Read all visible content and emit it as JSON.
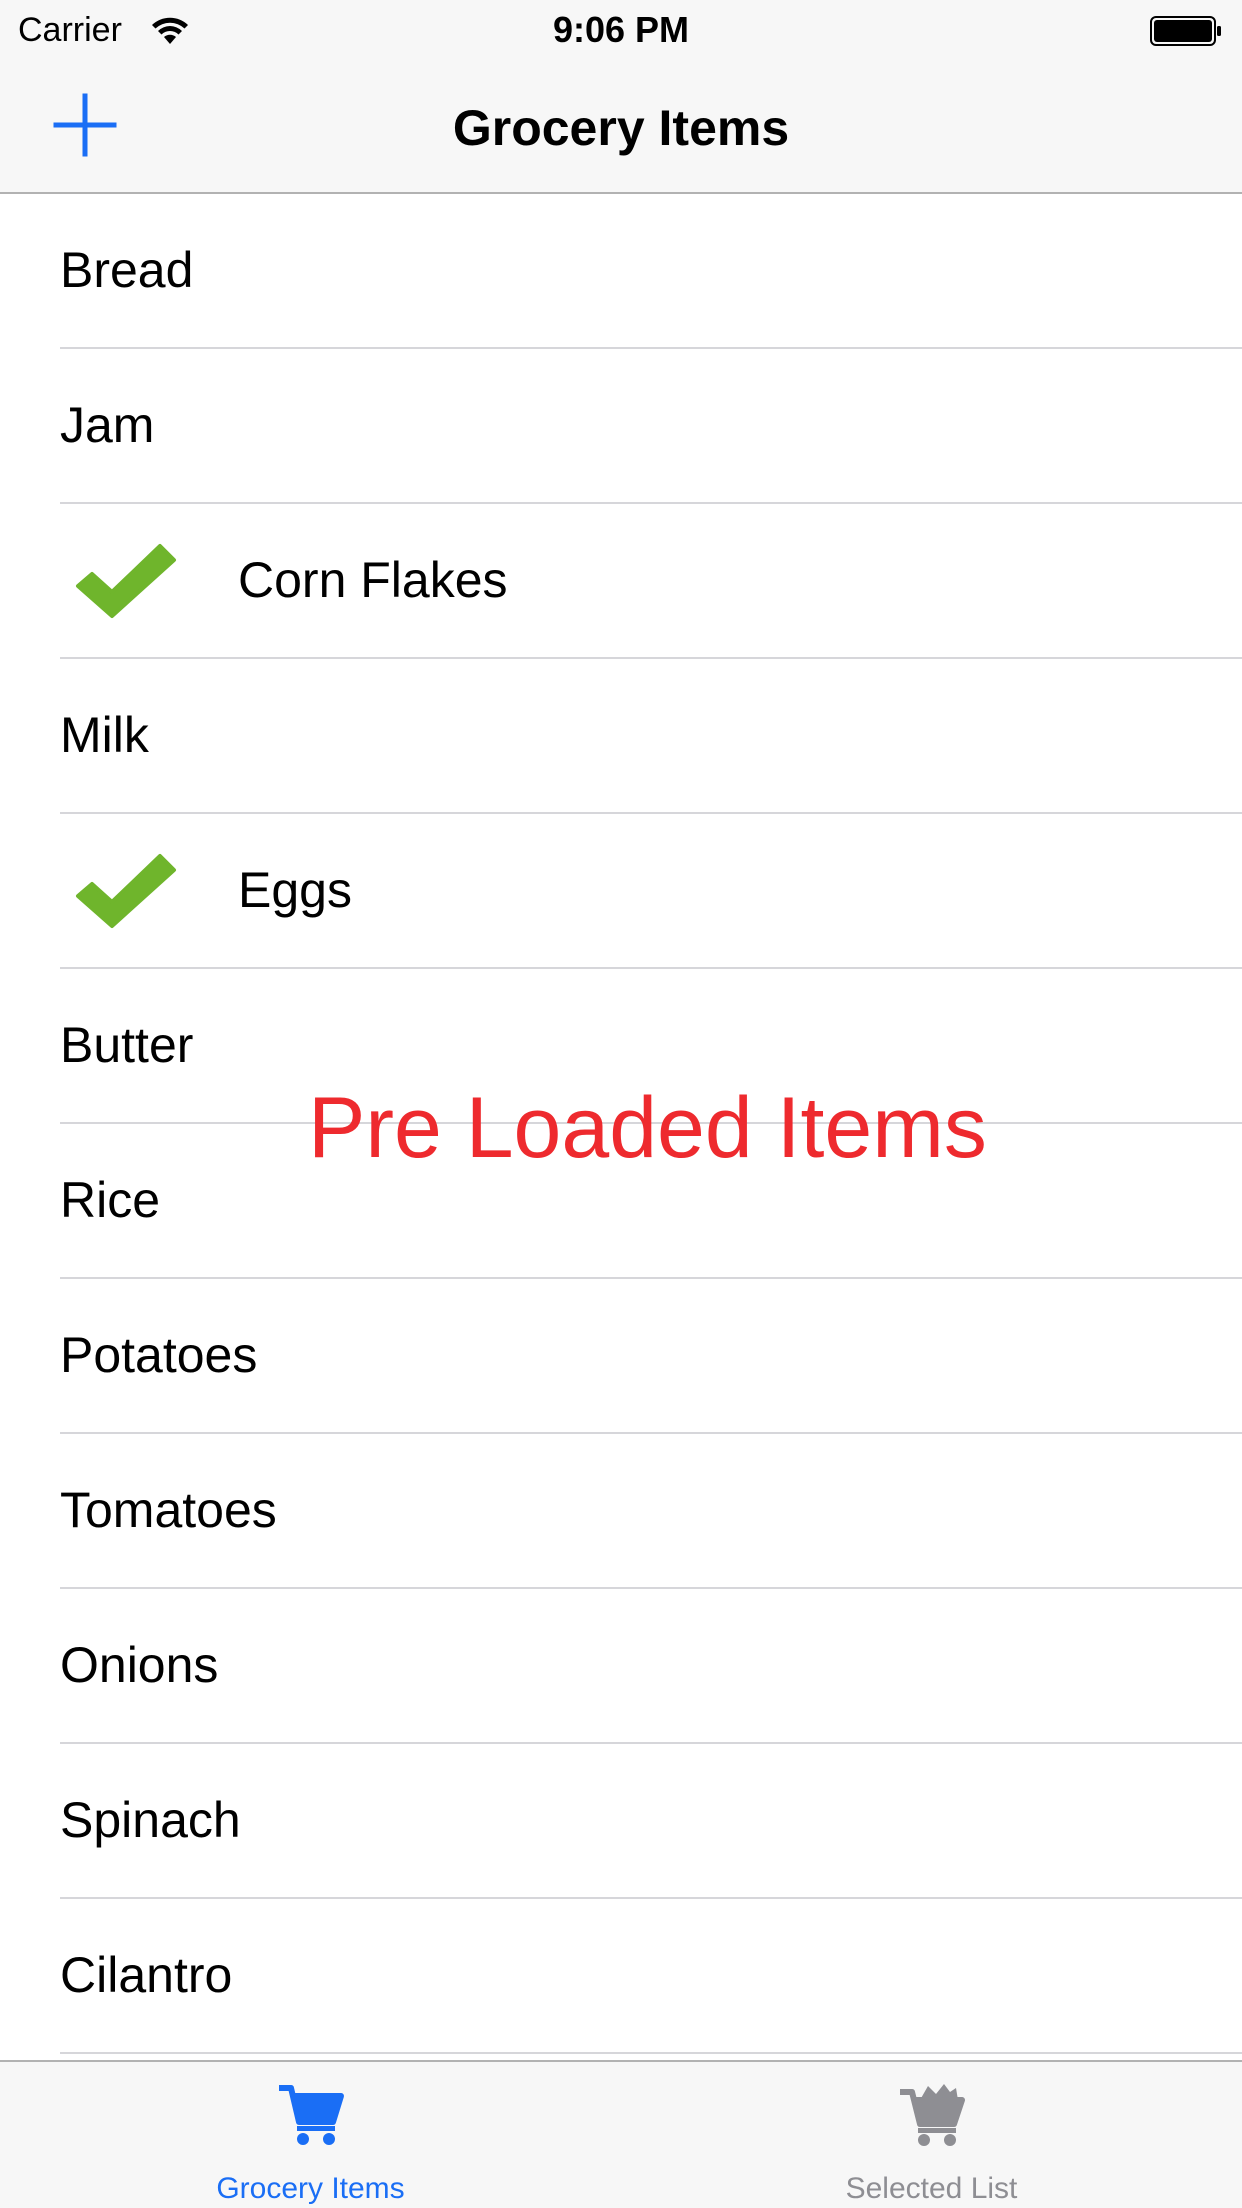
{
  "status_bar": {
    "carrier": "Carrier",
    "time": "9:06 PM"
  },
  "nav": {
    "title": "Grocery Items",
    "add_icon": "plus-icon"
  },
  "items": [
    {
      "label": "Bread",
      "checked": false
    },
    {
      "label": "Jam",
      "checked": false
    },
    {
      "label": "Corn Flakes",
      "checked": true
    },
    {
      "label": "Milk",
      "checked": false
    },
    {
      "label": "Eggs",
      "checked": true
    },
    {
      "label": "Butter",
      "checked": false
    },
    {
      "label": "Rice",
      "checked": false
    },
    {
      "label": "Potatoes",
      "checked": false
    },
    {
      "label": "Tomatoes",
      "checked": false
    },
    {
      "label": "Onions",
      "checked": false
    },
    {
      "label": "Spinach",
      "checked": false
    },
    {
      "label": "Cilantro",
      "checked": false
    }
  ],
  "overlay": {
    "text": "Pre Loaded Items",
    "color": "#ee2a2e"
  },
  "tabs": [
    {
      "label": "Grocery Items",
      "icon": "cart-icon",
      "active": true
    },
    {
      "label": "Selected List",
      "icon": "cart-full-icon",
      "active": false
    }
  ],
  "colors": {
    "accent": "#1a6ef5",
    "check": "#6fb52c",
    "inactive_tab": "#8e8e93"
  }
}
